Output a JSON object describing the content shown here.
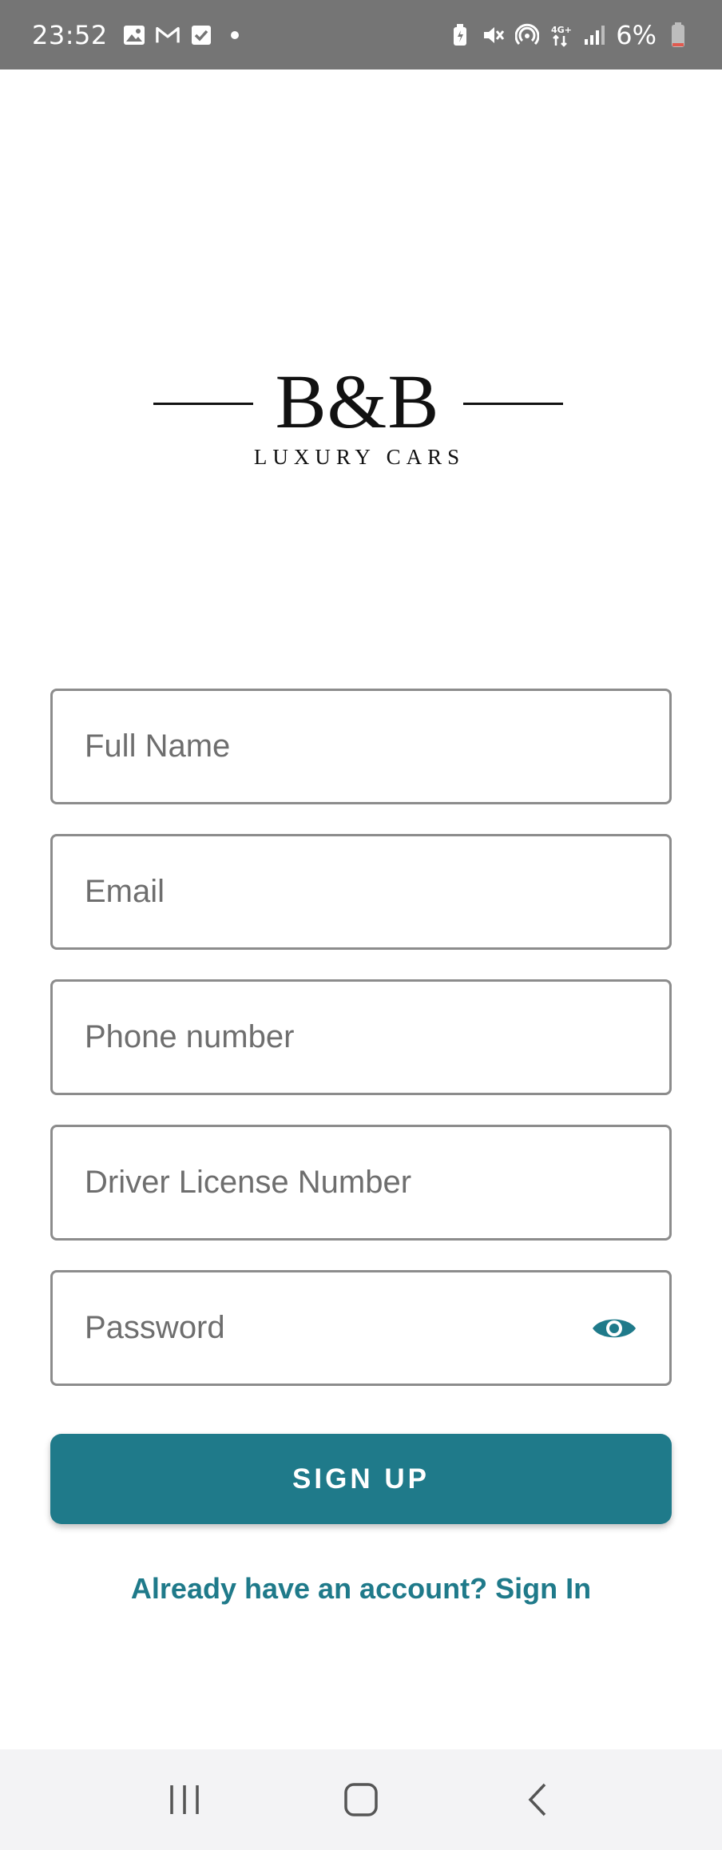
{
  "status_bar": {
    "time": "23:52",
    "battery_text": "6%",
    "left_icons": [
      "gallery-icon",
      "gmail-icon",
      "checkbox-icon",
      "dot-icon"
    ],
    "right_icons": [
      "battery-saver-icon",
      "mute-icon",
      "hotspot-icon",
      "4g-icon",
      "signal-icon",
      "battery-icon"
    ]
  },
  "logo": {
    "title": "B&B",
    "subtitle": "LUXURY CARS"
  },
  "form": {
    "full_name_placeholder": "Full Name",
    "email_placeholder": "Email",
    "phone_placeholder": "Phone number",
    "license_placeholder": "Driver License Number",
    "password_placeholder": "Password"
  },
  "signup_button_label": "SIGN UP",
  "signin_link": "Already have an account? Sign In",
  "colors": {
    "accent": "#1f7a8a",
    "status_bar": "#757575",
    "nav_bar": "#f3f3f5"
  },
  "nav_bar": {
    "icons": [
      "recent-apps-icon",
      "home-icon",
      "back-icon"
    ]
  }
}
